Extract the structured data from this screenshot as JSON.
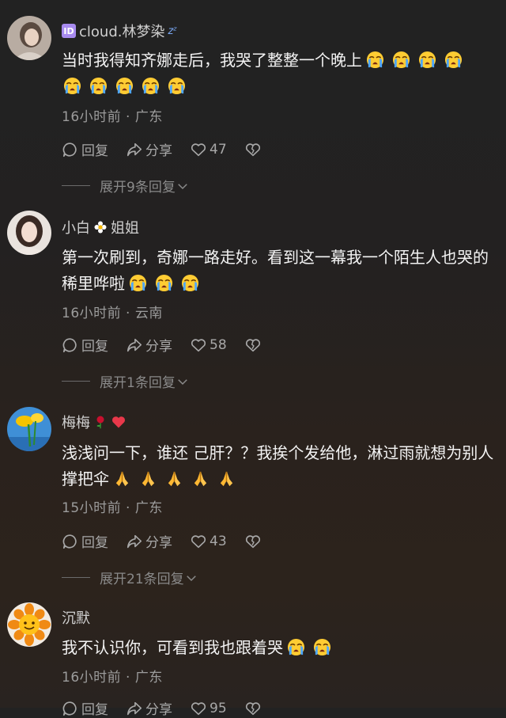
{
  "comments": [
    {
      "user": "cloud.林梦染",
      "badge": "ID",
      "user_suffix": "zᶻ",
      "text": "当时我得知齐娜走后，我哭了整整一个晚上",
      "emoji_count": 9,
      "time_location": "16小时前 · 广东",
      "reply_label": "回复",
      "share_label": "分享",
      "likes": "47",
      "expand_replies": "展开9条回复"
    },
    {
      "user_prefix": "小白",
      "user_suffix": "姐姐",
      "text": "第一次刷到，奇娜一路走好。看到这一幕我一个陌生人也哭的稀里哗啦",
      "emoji_count": 3,
      "time_location": "16小时前 · 云南",
      "reply_label": "回复",
      "share_label": "分享",
      "likes": "58",
      "expand_replies": "展开1条回复"
    },
    {
      "user": "梅梅",
      "text": "浅浅问一下，谁还 己肝？？我挨个发给他，淋过雨就想为别人撑把伞",
      "emoji_count": 5,
      "time_location": "15小时前 · 广东",
      "reply_label": "回复",
      "share_label": "分享",
      "likes": "43",
      "expand_replies": "展开21条回复"
    },
    {
      "user": "沉默",
      "text": "我不认识你，可看到我也跟着哭",
      "emoji_count": 2,
      "time_location": "16小时前 · 广东",
      "reply_label": "回复",
      "share_label": "分享",
      "likes": "95"
    }
  ],
  "icons": {
    "reply": "reply-bubble-icon",
    "share": "share-arrow-icon",
    "like": "heart-outline-icon",
    "dislike": "broken-heart-icon",
    "expand": "chevron-down-icon",
    "crying": "loudly-crying-face-emoji",
    "pray": "folded-hands-emoji",
    "flower": "flower-emoji",
    "rose": "rose-emoji",
    "heart": "red-heart-emoji"
  },
  "colors": {
    "username": "#cfcfcf",
    "meta": "#9c9c9c",
    "badge": "#a88bf0",
    "heart": "#e8384a"
  }
}
